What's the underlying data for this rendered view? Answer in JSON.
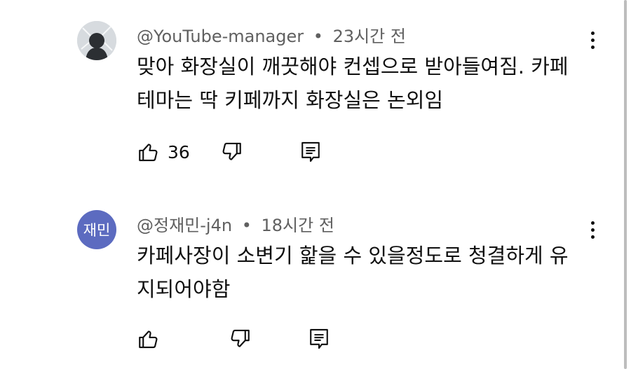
{
  "comments": [
    {
      "author": "@YouTube-manager",
      "separator": "•",
      "time": "23시간 전",
      "avatar": {
        "type": "photo",
        "color": "#d7dbdf"
      },
      "text_lines": [
        "맞아 화장실이 깨끗해야 컨셉으로 받아들여짐. 카페",
        "테마는 딱 키페까지 화장실은 논외임"
      ],
      "likes": "36",
      "icons": {
        "like": "thumbs-up-icon",
        "dislike": "thumbs-down-icon",
        "reply": "reply-icon",
        "menu": "more-vert-icon"
      }
    },
    {
      "author": "@정재민-j4n",
      "separator": "•",
      "time": "18시간 전",
      "avatar": {
        "type": "initials",
        "initials": "재민",
        "color": "#5c6bc0"
      },
      "text_lines": [
        "카페사장이 소변기 핥을 수 있을정도로 청결하게 유",
        "지되어야함"
      ],
      "likes": "",
      "icons": {
        "like": "thumbs-up-icon",
        "dislike": "thumbs-down-icon",
        "reply": "reply-icon",
        "menu": "more-vert-icon"
      }
    }
  ]
}
